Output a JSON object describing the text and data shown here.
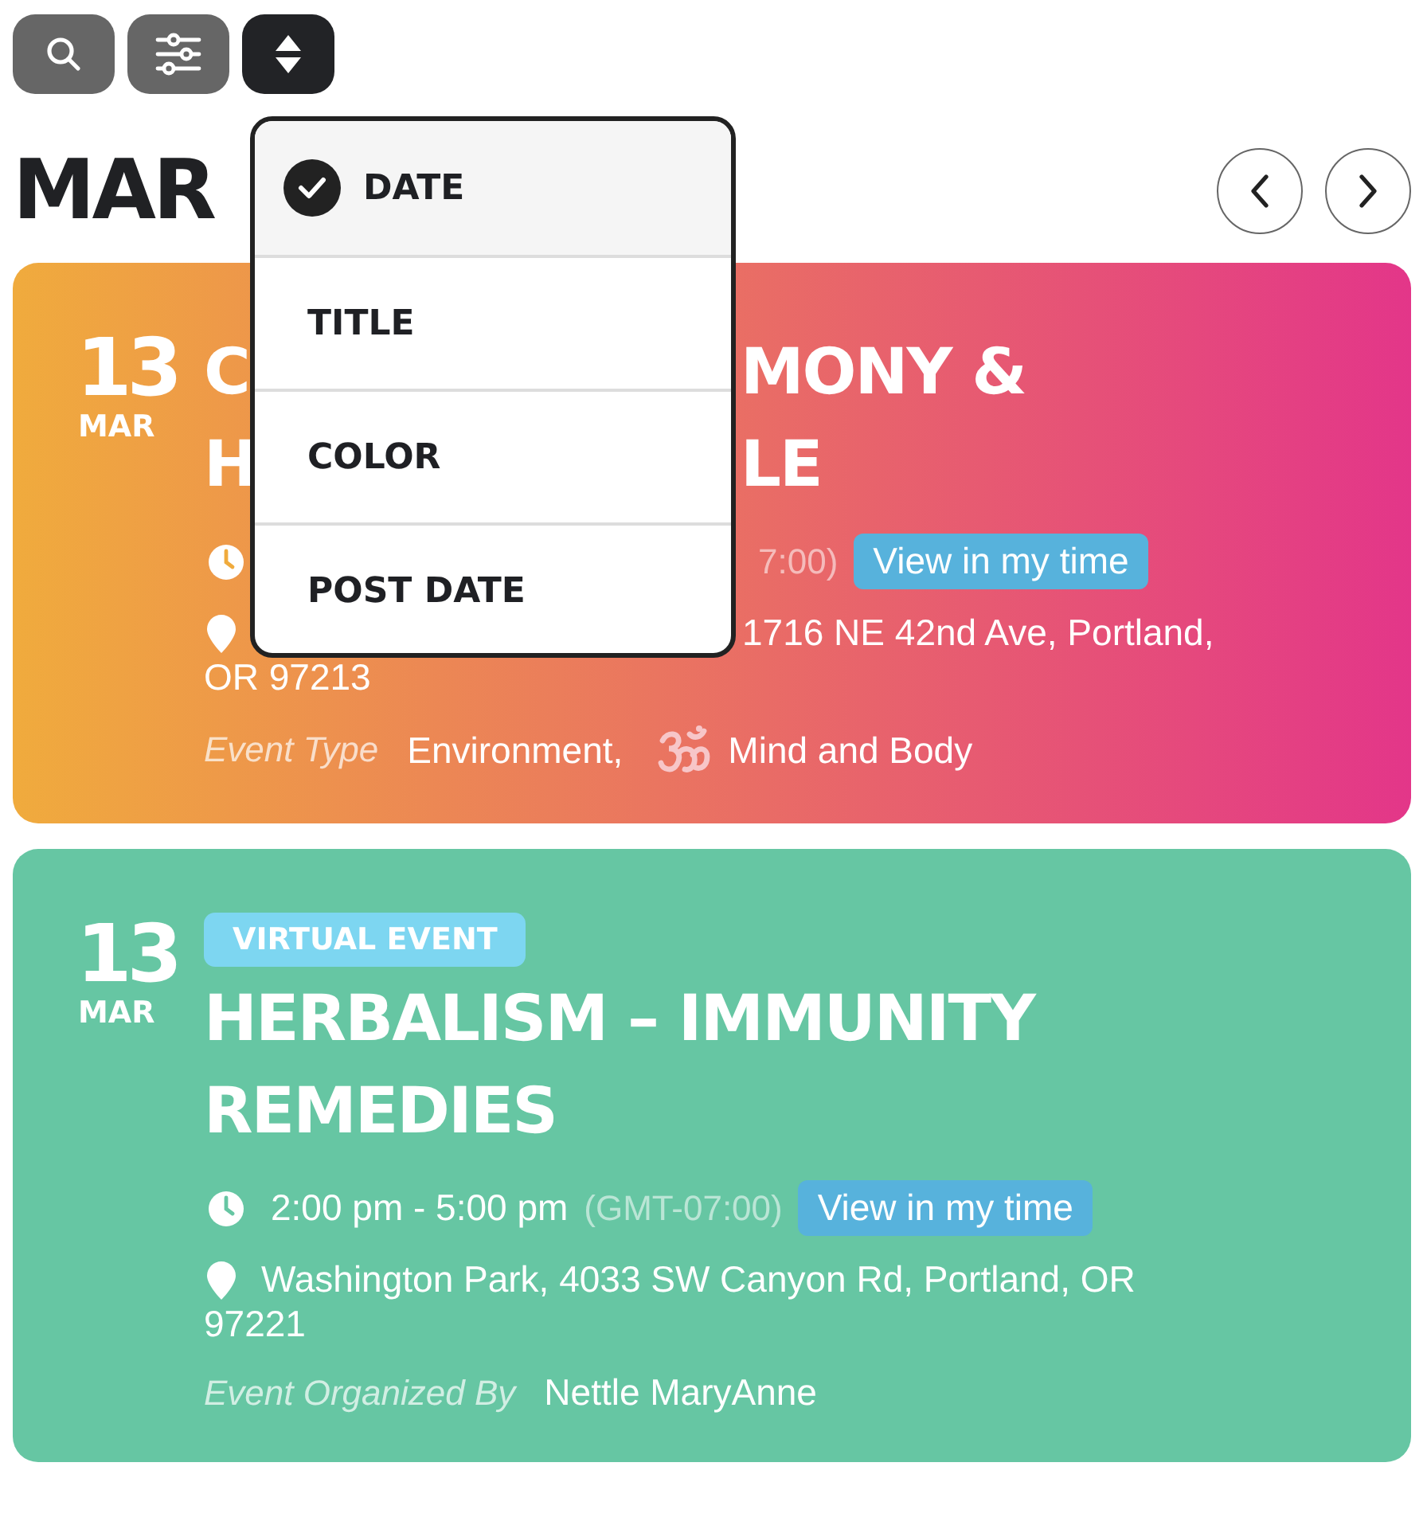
{
  "toolbar": [
    {
      "kind": "search",
      "selected": false
    },
    {
      "kind": "filter",
      "selected": false
    },
    {
      "kind": "sort",
      "selected": true
    }
  ],
  "sort_menu": {
    "items": [
      {
        "label": "DATE",
        "selected": true
      },
      {
        "label": "TITLE",
        "selected": false
      },
      {
        "label": "COLOR",
        "selected": false
      },
      {
        "label": "POST DATE",
        "selected": false
      }
    ]
  },
  "heading": "MAR",
  "nav": [
    {
      "kind": "prev"
    },
    {
      "kind": "next"
    }
  ],
  "events": [
    {
      "color": "#f0ab3d",
      "kind": "gradient",
      "day": "13",
      "month": "MAR",
      "title_lines": [
        {
          "left": "C",
          "right": "MONY &"
        },
        {
          "left": "H",
          "right": "LE"
        }
      ],
      "time": {
        "gmt": "7:00)",
        "button": "View in my time"
      },
      "location": [
        "1716 NE 42nd Ave, Portland,",
        "OR 97213"
      ],
      "meta": {
        "label": "Event Type",
        "values": [
          {
            "text": "Environment,",
            "kind": "plain"
          },
          {
            "text": "Mind and Body",
            "kind": "symbol"
          }
        ]
      }
    },
    {
      "color": "#66c6a3",
      "kind": "flat",
      "day": "13",
      "month": "MAR",
      "badge": "VIRTUAL EVENT",
      "title_lines": [
        {
          "left": "HERBALISM – IMMUNITY"
        },
        {
          "left": "REMEDIES"
        }
      ],
      "time": {
        "text": "2:00 pm - 5:00 pm",
        "gmt": "(GMT-07:00)",
        "button": "View in my time"
      },
      "location": [
        "Washington Park, 4033 SW Canyon Rd, Portland, OR",
        "97221"
      ],
      "meta": {
        "label": "Event Organized By",
        "values": [
          {
            "text": "Nettle MaryAnne",
            "kind": "plain"
          }
        ]
      }
    }
  ]
}
